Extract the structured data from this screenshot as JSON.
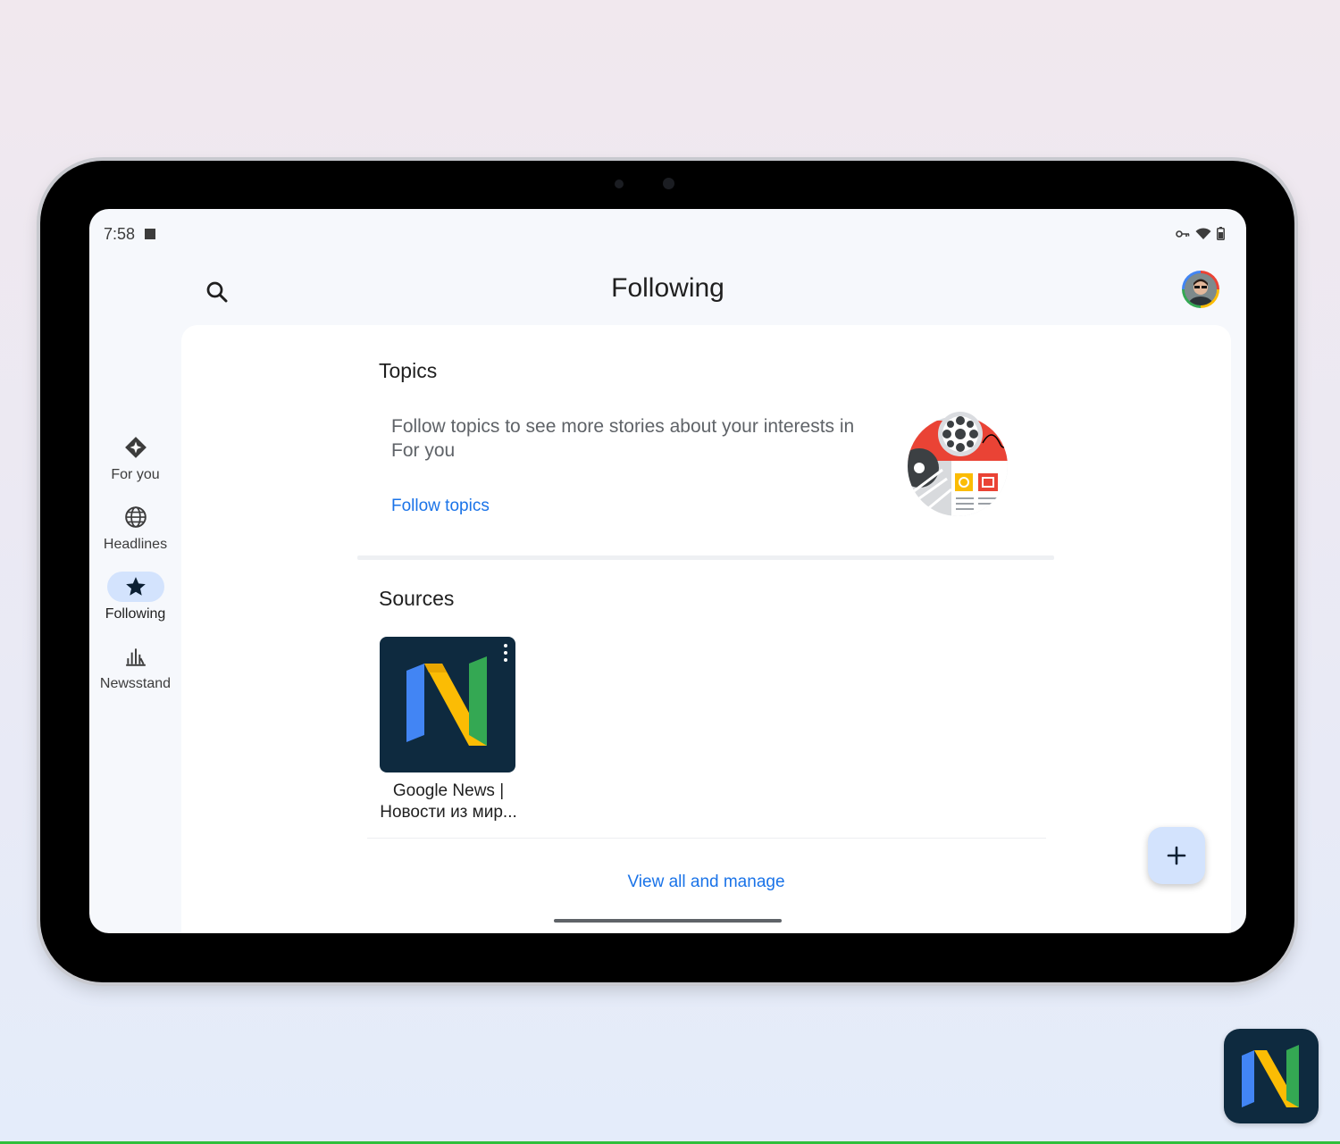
{
  "status_bar": {
    "time": "7:58",
    "icons": [
      "vpn-key-icon",
      "wifi-icon",
      "battery-icon"
    ]
  },
  "app_bar": {
    "title": "Following",
    "search_icon": "search-icon",
    "avatar": "profile-avatar"
  },
  "nav": {
    "items": [
      {
        "label": "For you",
        "icon": "for-you-icon",
        "active": false
      },
      {
        "label": "Headlines",
        "icon": "globe-icon",
        "active": false
      },
      {
        "label": "Following",
        "icon": "star-icon",
        "active": true
      },
      {
        "label": "Newsstand",
        "icon": "newsstand-icon",
        "active": false
      }
    ]
  },
  "topics": {
    "title": "Topics",
    "description": "Follow topics to see more stories about your interests in For you",
    "link": "Follow topics"
  },
  "sources": {
    "title": "Sources",
    "items": [
      {
        "name": "Google News | Новости из мир..."
      }
    ],
    "manage_link": "View all and manage"
  },
  "fab": {
    "icon": "plus-icon"
  },
  "colors": {
    "accent": "#1a73e8",
    "active_pill": "#d3e3fd",
    "logo_blue": "#4285f4",
    "logo_yellow": "#fbbc04",
    "logo_green": "#34a853",
    "logo_bg": "#0e2a3f"
  }
}
